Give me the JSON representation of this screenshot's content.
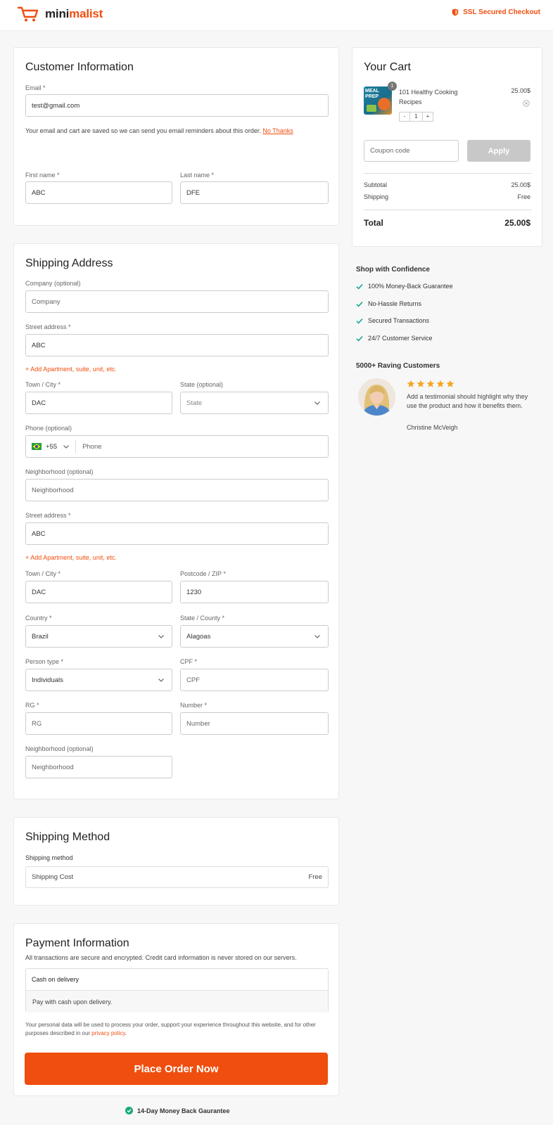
{
  "brand": {
    "name_prefix": "mini",
    "name_accent": "malist",
    "accent_color": "#f04e0f"
  },
  "header": {
    "ssl_text": "SSL Secured Checkout"
  },
  "customer": {
    "title": "Customer Information",
    "email_label": "Email *",
    "email_value": "test@gmail.com",
    "email_note": "Your email and cart are saved so we can send you email reminders about this order.",
    "no_thanks": "No Thanks",
    "first_name_label": "First name *",
    "first_name_value": "ABC",
    "last_name_label": "Last name *",
    "last_name_value": "DFE"
  },
  "shipping_address": {
    "title": "Shipping Address",
    "company_label": "Company (optional)",
    "company_placeholder": "Company",
    "street1_label": "Street address *",
    "street1_value": "ABC",
    "add_apartment1": "+ Add Apartment, suite, unit, etc.",
    "town1_label": "Town / City *",
    "town1_value": "DAC",
    "state_opt_label": "State (optional)",
    "state_opt_placeholder": "State",
    "phone_label": "Phone (optional)",
    "phone_code": "+55",
    "phone_placeholder": "Phone",
    "neigh1_label": "Neighborhood (optional)",
    "neigh1_placeholder": "Neighborhood",
    "street2_label": "Street address *",
    "street2_value": "ABC",
    "add_apartment2": "+ Add Apartment, suite, unit, etc.",
    "town2_label": "Town / City *",
    "town2_value": "DAC",
    "postcode_label": "Postcode / ZIP *",
    "postcode_value": "1230",
    "country_label": "Country *",
    "country_value": "Brazil",
    "state_county_label": "State / County *",
    "state_county_value": "Alagoas",
    "person_type_label": "Person type  *",
    "person_type_value": "Individuals",
    "cpf_label": "CPF  *",
    "cpf_placeholder": "CPF",
    "rg_label": "RG  *",
    "rg_placeholder": "RG",
    "number_label": "Number *",
    "number_placeholder": "Number",
    "neigh2_label": "Neighborhood (optional)",
    "neigh2_placeholder": "Neighborhood"
  },
  "shipping_method": {
    "title": "Shipping Method",
    "label": "Shipping method",
    "option_name": "Shipping Cost",
    "option_price": "Free"
  },
  "payment": {
    "title": "Payment Information",
    "subtitle": "All transactions are secure and encrypted. Credit card information is never stored on our servers.",
    "method_name": "Cash on delivery",
    "method_desc": "Pay with cash upon delivery.",
    "privacy_text": "Your personal data will be used to process your order, support your experience throughout this website, and for other purposes described in our",
    "privacy_link": "privacy policy",
    "place_order": "Place Order Now",
    "guarantee": "14-Day Money Back Gaurantee"
  },
  "cart": {
    "title": "Your Cart",
    "item_name": "101 Healthy Cooking Recipes",
    "item_price": "25.00$",
    "item_badge": "1",
    "item_image_text": "MEAL PREP",
    "qty_minus": "-",
    "qty_value": "1",
    "qty_plus": "+",
    "coupon_placeholder": "Coupon code",
    "apply_label": "Apply",
    "subtotal_label": "Subtotal",
    "subtotal_value": "25.00$",
    "shipping_label": "Shipping",
    "shipping_value": "Free",
    "total_label": "Total",
    "total_value": "25.00$"
  },
  "confidence": {
    "title": "Shop with Confidence",
    "items": [
      "100% Money-Back Guarantee",
      "No-Hassle Returns",
      "Secured Transactions",
      "24/7 Customer Service"
    ]
  },
  "testimonial": {
    "title": "5000+ Raving Customers",
    "stars": 5,
    "text": "Add a testimonial should highlight why they use the product and how it benefits them.",
    "author": "Christine McVeigh"
  }
}
